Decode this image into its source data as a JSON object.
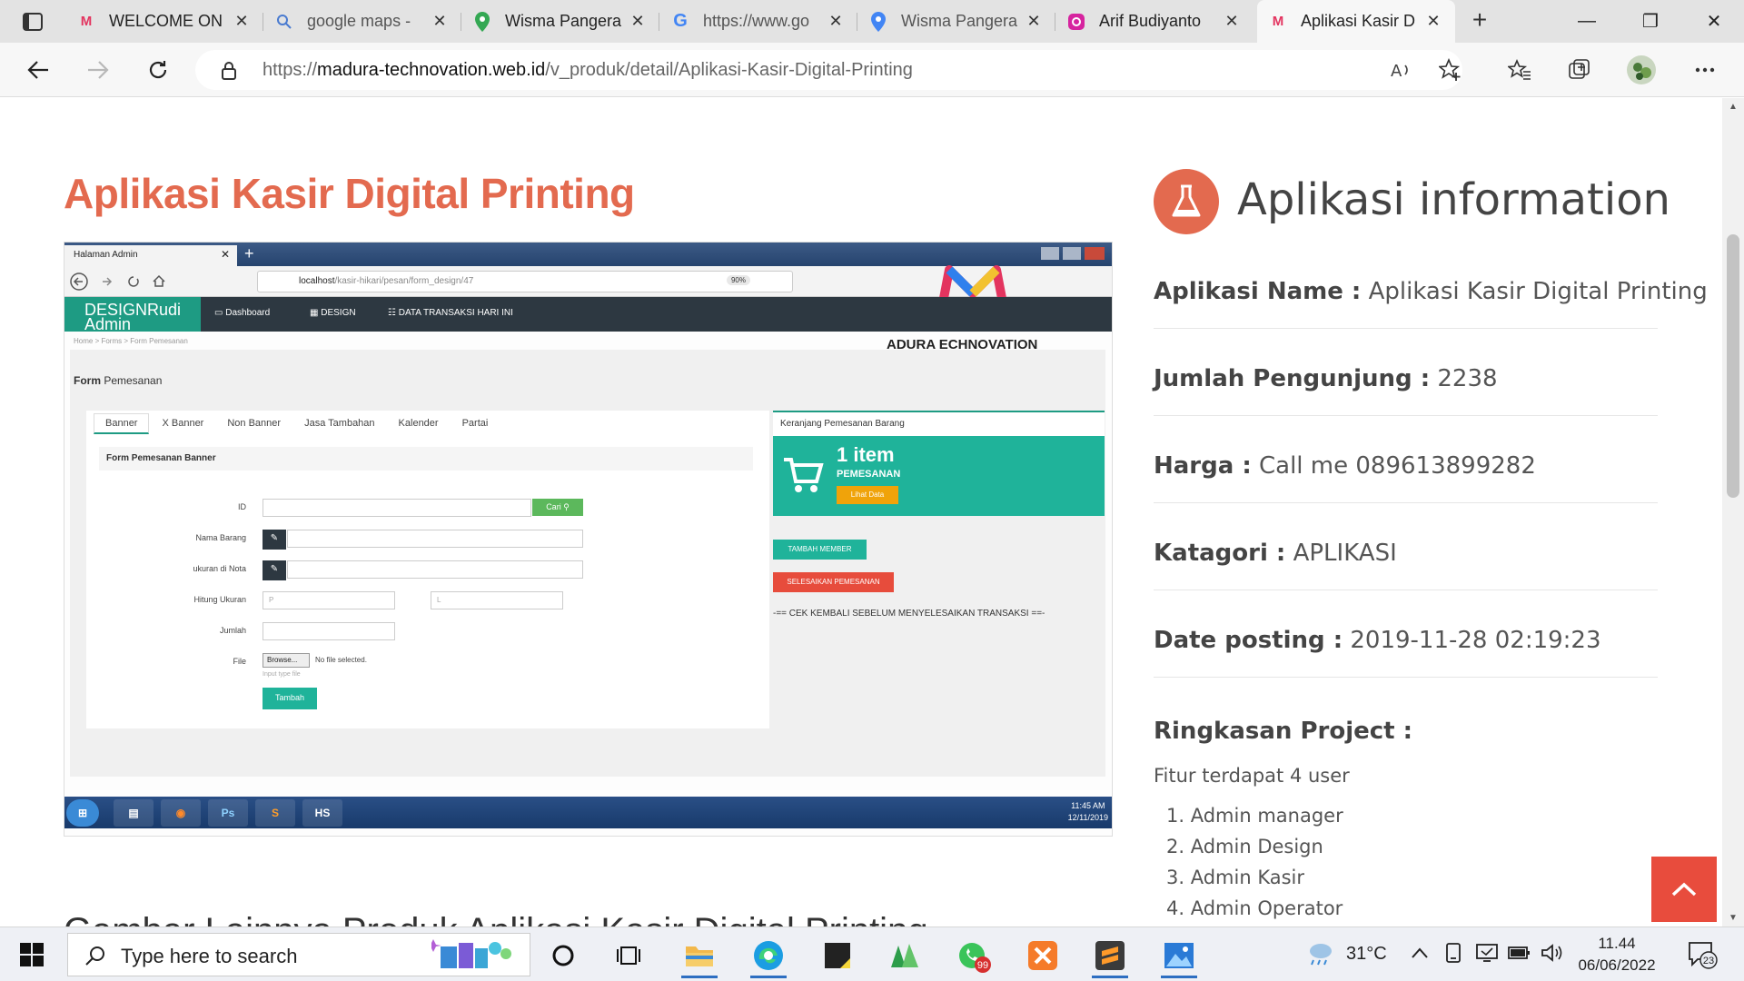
{
  "browser": {
    "tabs": [
      {
        "title": "WELCOME ON",
        "favicon": "m-logo-icon"
      },
      {
        "title": "google maps -",
        "favicon": "search-icon"
      },
      {
        "title": "Wisma Pangera",
        "favicon": "maps-pin-icon"
      },
      {
        "title": "https://www.go",
        "favicon": "google-icon"
      },
      {
        "title": "Wisma Pangera",
        "favicon": "maps-pin-icon"
      },
      {
        "title": "Arif Budiyanto",
        "favicon": "instagram-icon"
      },
      {
        "title": "Aplikasi Kasir D",
        "favicon": "m-logo-icon",
        "active": true
      }
    ],
    "url_prefix": "https://",
    "url_host": "madura-technovation.web.id",
    "url_path": "/v_produk/detail/Aplikasi-Kasir-Digital-Printing"
  },
  "page": {
    "product_title": "Aplikasi Kasir Digital Printing",
    "gallery_heading": "Gambar Lainnya Produk Aplikasi Kasir Digital Printing",
    "screenshot": {
      "tab_title": "Halaman Admin",
      "url_host": "localhost",
      "url_path": "/kasir-hikari/pesan/form_design/47",
      "zoom": "90%",
      "brand": "DESIGNRudi Admin",
      "menu": [
        "Dashboard",
        "DESIGN",
        "DATA TRANSAKSI HARI INI"
      ],
      "breadcrumb": "Home  >  Forms  >  Form Pemesanan",
      "logo_text": "ADURA  ECHNOVATION",
      "form_heading_bold": "Form",
      "form_heading_rest": " Pemesanan",
      "tabs": [
        "Banner",
        "X Banner",
        "Non Banner",
        "Jasa Tambahan",
        "Kalender",
        "Partai"
      ],
      "subhead": "Form Pemesanan Banner",
      "labels": [
        "ID",
        "Nama Barang",
        "ukuran di Nota",
        "Hitung Ukuran",
        "Jumlah",
        "File"
      ],
      "search_btn": "Cari",
      "p_placeholder": "P",
      "l_placeholder": "L",
      "browse_btn": "Browse...",
      "no_file": "No file selected.",
      "file_hint": "Input type file",
      "add_btn": "Tambah",
      "cart_heading": "Keranjang Pemesanan Barang",
      "cart_count": "1 item",
      "cart_label": "PEMESANAN",
      "cart_view": "Lihat Data",
      "member_btn": "TAMBAH MEMBER",
      "finish_btn": "SELESAIKAN PEMESANAN",
      "warning": "-== CEK KEMBALI SEBELUM MENYELESAIKAN TRANSAKSI ==-",
      "clock_time": "11:45 AM",
      "clock_date": "12/11/2019"
    },
    "info": {
      "title": "Aplikasi information",
      "rows": [
        {
          "key": "Aplikasi Name :",
          "value": " Aplikasi Kasir Digital Printing"
        },
        {
          "key": "Jumlah Pengunjung :",
          "value": " 2238"
        },
        {
          "key": "Harga :",
          "value": " Call me 089613899282"
        },
        {
          "key": "Katagori :",
          "value": " APLIKASI"
        },
        {
          "key": "Date posting :",
          "value": " 2019-11-28 02:19:23"
        }
      ],
      "summary_label": "Ringkasan Project :",
      "summary_text": "Fitur terdapat 4 user",
      "users": [
        "1. Admin manager",
        "2. Admin Design",
        "3. Admin Kasir",
        "4. Admin Operator"
      ]
    }
  },
  "taskbar": {
    "search_placeholder": "Type here to search",
    "temperature": "31°C",
    "time": "11.44",
    "date": "06/06/2022",
    "notification_count": "23",
    "whatsapp_badge": "99"
  },
  "colors": {
    "accent": "#e36a4f",
    "teal": "#1fb39a",
    "red": "#e74c3c"
  }
}
